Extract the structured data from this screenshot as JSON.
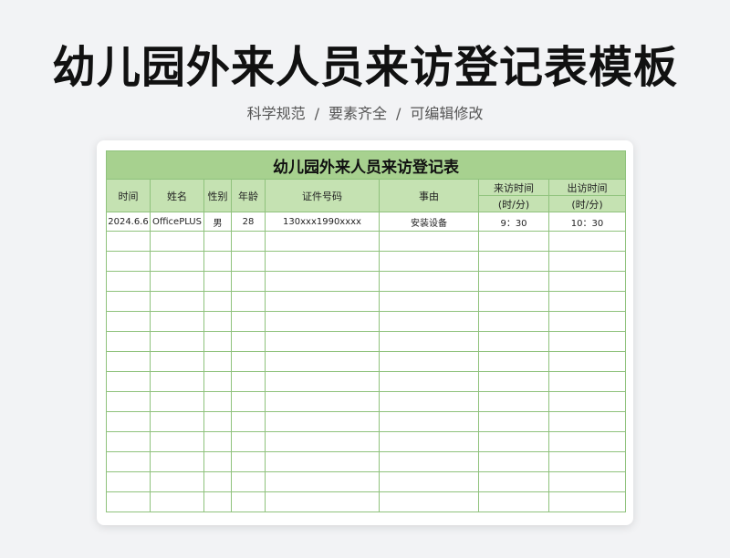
{
  "header": {
    "title": "幼儿园外来人员来访登记表模板",
    "subtitle_parts": [
      "科学规范",
      "要素齐全",
      "可编辑修改"
    ],
    "separator": "/"
  },
  "table": {
    "title": "幼儿园外来人员来访登记表",
    "columns": {
      "time": "时间",
      "name": "姓名",
      "gender": "性别",
      "age": "年龄",
      "id_number": "证件号码",
      "reason": "事由",
      "arrive_time": "来访时间",
      "arrive_unit": "(时/分)",
      "leave_time": "出访时间",
      "leave_unit": "(时/分)"
    },
    "rows": [
      [
        "2024.6.6",
        "OfficePLUS",
        "男",
        "28",
        "130xxx1990xxxx",
        "安装设备",
        "9：30",
        "10：30"
      ]
    ],
    "blank_row_count": 14
  },
  "colors": {
    "title_bg": "#a7d18f",
    "header_bg": "#c5e2b2",
    "border": "#8fc27c"
  }
}
